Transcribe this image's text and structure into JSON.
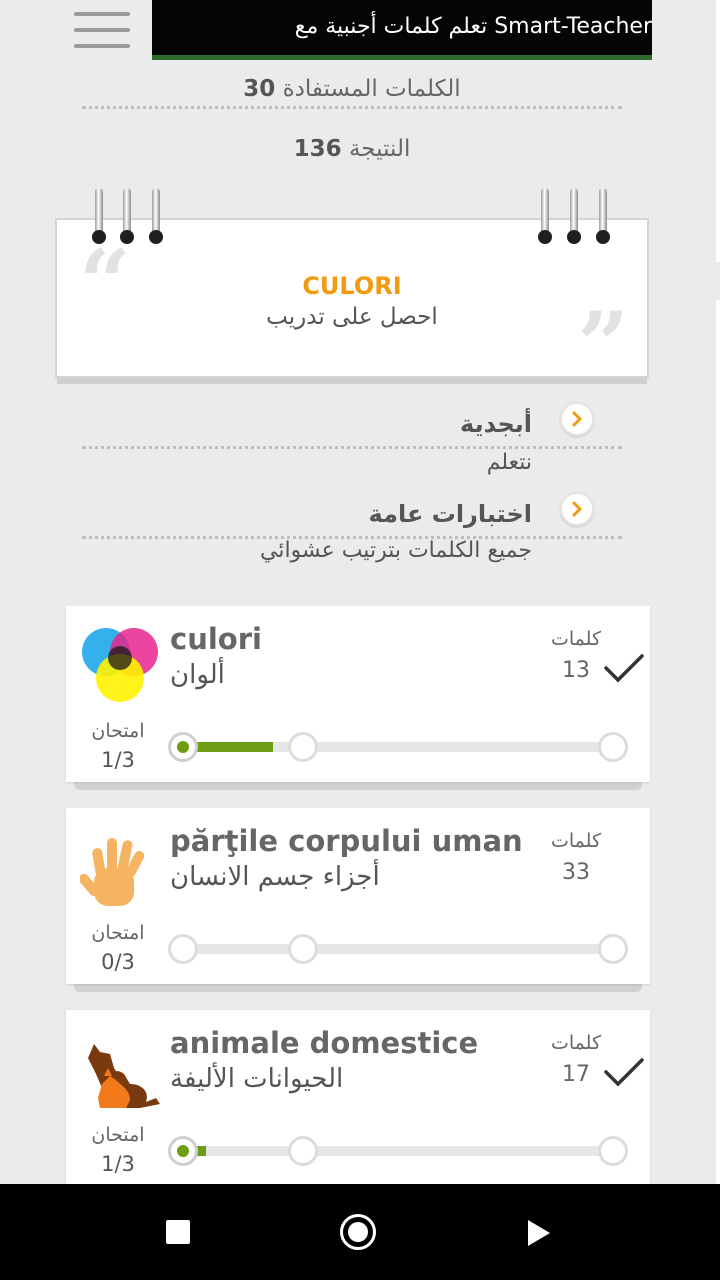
{
  "header": {
    "banner_text": "تعلم كلمات أجنبية مع Smart-Teacher",
    "learned_words_label": "الكلمات المستفادة",
    "learned_words_value": "30",
    "score_label": "النتيجة",
    "score_value": "136"
  },
  "note": {
    "title": "CULORI",
    "subtitle": "احصل على تدريب"
  },
  "menu": [
    {
      "title": "أبجدية",
      "subtitle": "نتعلم"
    },
    {
      "title": "اختبارات عامة",
      "subtitle": "جميع الكلمات بترتيب عشوائي"
    }
  ],
  "categories": [
    {
      "name": "culori",
      "translation": "ألوان",
      "words_label": "كلمات",
      "words_count": "13",
      "exam_label": "امتحان",
      "exam_progress": "1/3",
      "completed": true,
      "progress_fraction": 0.33,
      "icon": "color-wheel-icon"
    },
    {
      "name": "părţile corpului uman",
      "translation": "أجزاء جسم الانسان",
      "words_label": "كلمات",
      "words_count": "33",
      "exam_label": "امتحان",
      "exam_progress": "0/3",
      "completed": false,
      "progress_fraction": 0,
      "icon": "hand-icon"
    },
    {
      "name": "animale domestice",
      "translation": "الحيوانات الأليفة",
      "words_label": "كلمات",
      "words_count": "17",
      "exam_label": "امتحان",
      "exam_progress": "1/3",
      "completed": true,
      "progress_fraction": 0.05,
      "icon": "dog-cat-icon"
    }
  ],
  "colors": {
    "accent": "#f29a12",
    "progress": "#6d9d12"
  }
}
